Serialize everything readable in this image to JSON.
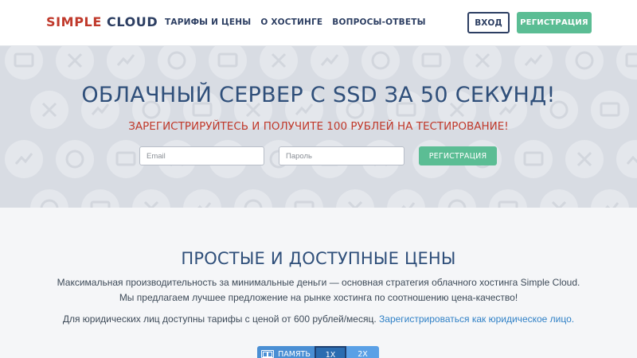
{
  "header": {
    "logo_part1": "SIMPLE",
    "logo_part2": "CLOUD",
    "nav": [
      "ТАРИФЫ И ЦЕНЫ",
      "О ХОСТИНГЕ",
      "ВОПРОСЫ-ОТВЕТЫ"
    ],
    "login_label": "ВХОД",
    "register_label": "РЕГИСТРАЦИЯ"
  },
  "hero": {
    "title": "ОБЛАЧНЫЙ СЕРВЕР С SSD ЗА 50 СЕКУНД!",
    "subtitle": "ЗАРЕГИСТРИРУЙТЕСЬ И ПОЛУЧИТЕ 100 РУБЛЕЙ НА ТЕСТИРОВАНИЕ!",
    "email_placeholder": "Email",
    "password_placeholder": "Пароль",
    "register_label": "РЕГИСТРАЦИЯ"
  },
  "pricing": {
    "title": "ПРОСТЫЕ И ДОСТУПНЫЕ ЦЕНЫ",
    "line1": "Максимальная производительность за минимальные деньги — основная стратегия облачного хостинга Simple Cloud.",
    "line2": "Мы предлагаем лучшее предложение на рынке хостинга по соотношению цена-качество!",
    "line3_text": "Для юридических лиц доступны тарифы с ценой от 600 рублей/месяц.",
    "line3_link": "Зарегистрироваться как юридическое лицо.",
    "toggle": {
      "memory_label": "ПАМЯТЬ",
      "option1": "1X",
      "option2": "2X",
      "selected": "1X"
    }
  },
  "colors": {
    "brand_red": "#c0392b",
    "brand_navy": "#2c3e62",
    "accent_green": "#5bbd94",
    "link_blue": "#2f80c6",
    "hero_bg": "#d8dce3"
  }
}
